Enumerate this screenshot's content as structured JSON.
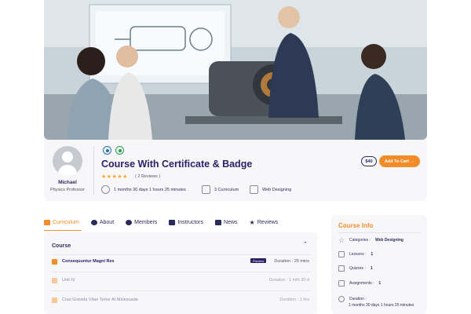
{
  "instructor": {
    "name": "Michael",
    "role": "Physics Professor"
  },
  "course": {
    "title": "Course With Certificate & Badge",
    "rating_stars": "★★★★★",
    "reviews_text": "( 2 Reviews )",
    "duration": "1 months 30 days 1 hours 25 minutes",
    "curriculum": "3 Curriculum",
    "category": "Web Designing",
    "price": "$40",
    "add_to_cart": "Add To Cart →"
  },
  "tabs": [
    {
      "label": "Curriculum",
      "active": true
    },
    {
      "label": "About"
    },
    {
      "label": "Members"
    },
    {
      "label": "Instructors"
    },
    {
      "label": "News"
    },
    {
      "label": "Reviews"
    }
  ],
  "curriculum_section": {
    "heading": "Course",
    "lessons": [
      {
        "title": "Consequuntur Magni Res",
        "badge": "Preview",
        "duration": "Duration : 25 mins"
      },
      {
        "title": "Unit IV",
        "duration": "Duration : 1 mth 30 d"
      },
      {
        "title": "Cras Gravida Vitae Tortor At Malesuada",
        "duration": "Duration : 1 hrs"
      }
    ]
  },
  "course_info": {
    "title": "Course Info",
    "categories_label": "Categories :",
    "categories_value": "Web Designing",
    "lessons_label": "Lessons :",
    "lessons_value": "1",
    "quizzes_label": "Quizzes :",
    "quizzes_value": "1",
    "assignments_label": "Assignments :",
    "assignments_value": "1",
    "duration_label": "Duration :",
    "duration_value": "1 months 30 days 1 hours 25 minutes"
  },
  "colors": {
    "accent": "#f28c28",
    "title": "#2b2168",
    "card": "#f7f7fa"
  },
  "icons": [
    "graduation-icon",
    "certificate-icon",
    "clock-icon",
    "book-icon",
    "category-icon",
    "star-icon"
  ]
}
